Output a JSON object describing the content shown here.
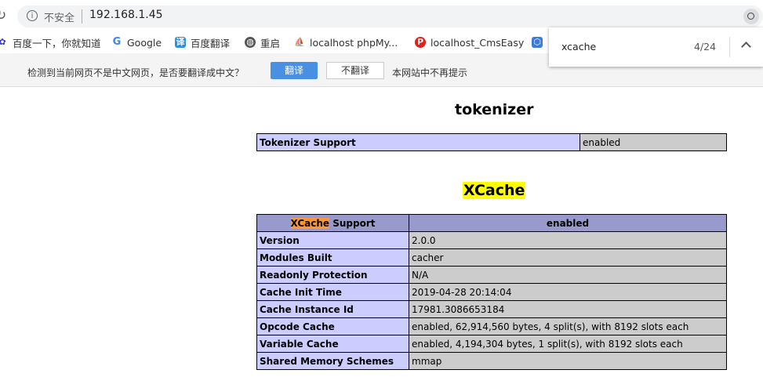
{
  "browser": {
    "insecure_label": "不安全",
    "url": "192.168.1.45"
  },
  "bookmarks": [
    {
      "label": "百度一下，你就知道",
      "icon": "baidu-paw-icon"
    },
    {
      "label": "Google",
      "icon": "google-g-icon"
    },
    {
      "label": "百度翻译",
      "icon": "baidu-translate-icon"
    },
    {
      "label": "重启",
      "icon": "globe-icon"
    },
    {
      "label": "localhost phpMy...",
      "icon": "phpmyadmin-icon"
    },
    {
      "label": "localhost_CmsEasy",
      "icon": "p-badge-icon"
    }
  ],
  "translate_bar": {
    "message": "检测到当前网页不是中文网页，是否要翻译成中文？",
    "translate_label": "翻译",
    "no_translate_label": "不翻译",
    "never_label": "本网站中不再提示"
  },
  "find_bar": {
    "query": "xcache",
    "count": "4/24"
  },
  "tokenizer": {
    "title": "tokenizer",
    "row": {
      "key": "Tokenizer Support",
      "value": "enabled"
    }
  },
  "xcache": {
    "title": "XCache",
    "header_highlight": "XCache",
    "header_rest": " Support",
    "header_value": "enabled",
    "rows": [
      {
        "key": "Version",
        "value": "2.0.0"
      },
      {
        "key": "Modules Built",
        "value": "cacher"
      },
      {
        "key": "Readonly Protection",
        "value": "N/A"
      },
      {
        "key": "Cache Init Time",
        "value": "2019-04-28 20:14:04"
      },
      {
        "key": "Cache Instance Id",
        "value": "17981.3086653184"
      },
      {
        "key": "Opcode Cache",
        "value": "enabled, 62,914,560 bytes, 4 split(s), with 8192 slots each"
      },
      {
        "key": "Variable Cache",
        "value": "enabled, 4,194,304 bytes, 1 split(s), with 8192 slots each"
      },
      {
        "key": "Shared Memory Schemes",
        "value": "mmap"
      }
    ]
  }
}
